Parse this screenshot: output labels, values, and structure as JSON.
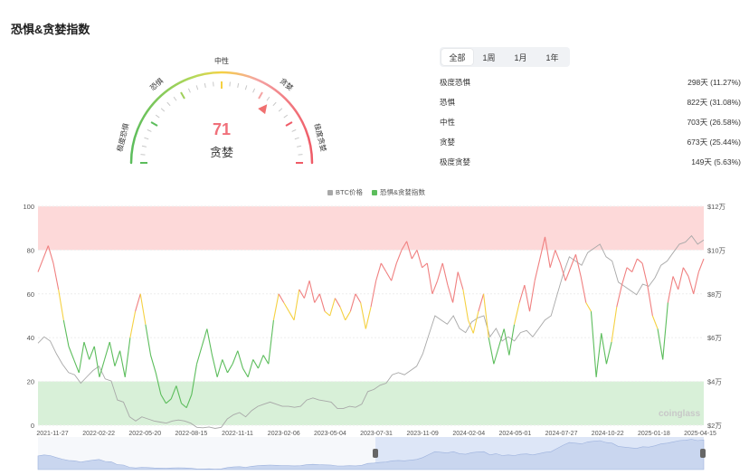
{
  "title": "恐惧&贪婪指数",
  "gauge": {
    "value": "71",
    "state": "贪婪",
    "labels": {
      "extreme_fear": "极度恐惧",
      "fear": "恐惧",
      "neutral": "中性",
      "greed": "贪婪",
      "extreme_greed": "极度贪婪"
    },
    "value_color": "#f0707a"
  },
  "tabs": [
    {
      "label": "全部",
      "active": true
    },
    {
      "label": "1周",
      "active": false
    },
    {
      "label": "1月",
      "active": false
    },
    {
      "label": "1年",
      "active": false
    }
  ],
  "stats": [
    {
      "label": "极度恐惧",
      "value": "298天 (11.27%)"
    },
    {
      "label": "恐惧",
      "value": "822天 (31.08%)"
    },
    {
      "label": "中性",
      "value": "703天 (26.58%)"
    },
    {
      "label": "贪婪",
      "value": "673天 (25.44%)"
    },
    {
      "label": "极度贪婪",
      "value": "149天 (5.63%)"
    }
  ],
  "legend": [
    {
      "label": "BTC价格",
      "color": "#a8a8a8"
    },
    {
      "label": "恐惧&贪婪指数",
      "color": "#5cbd5c"
    }
  ],
  "watermark": "coinglass",
  "chart_data": {
    "type": "line",
    "x": [
      "2021-11-27",
      "2022-02-22",
      "2022-05-20",
      "2022-08-15",
      "2022-11-11",
      "2023-02-06",
      "2023-05-04",
      "2023-07-31",
      "2023-11-09",
      "2024-02-04",
      "2024-05-01",
      "2024-07-27",
      "2024-10-22",
      "2025-01-18",
      "2025-04-15"
    ],
    "y_left": {
      "ticks": [
        "0",
        "20",
        "40",
        "60",
        "80",
        "100"
      ],
      "range": [
        0,
        100
      ]
    },
    "y_right": {
      "ticks": [
        "$2万",
        "$4万",
        "$6万",
        "$8万",
        "$10万",
        "$12万"
      ],
      "range": [
        18000,
        122000
      ]
    },
    "colors": {
      "extreme_fear": "#5cbd5c",
      "fear": "#5cbd5c",
      "neutral": "#f5d142",
      "greed": "#f08080",
      "extreme_greed": "#f08080",
      "btc": "#a8a8a8",
      "band_top": "#fdd9d9",
      "band_bottom": "#d8f0d8"
    },
    "series": [
      {
        "name": "恐惧&贪婪指数",
        "values": [
          70,
          76,
          82,
          74,
          62,
          48,
          36,
          30,
          24,
          38,
          30,
          36,
          22,
          30,
          38,
          27,
          34,
          22,
          40,
          52,
          60,
          46,
          32,
          24,
          14,
          10,
          12,
          18,
          10,
          8,
          14,
          28,
          36,
          44,
          32,
          22,
          30,
          24,
          28,
          34,
          26,
          22,
          30,
          26,
          32,
          28,
          48,
          60,
          56,
          52,
          48,
          62,
          58,
          66,
          56,
          60,
          52,
          50,
          58,
          54,
          48,
          52,
          60,
          56,
          44,
          54,
          66,
          74,
          70,
          66,
          74,
          80,
          84,
          76,
          80,
          72,
          74,
          60,
          66,
          74,
          64,
          56,
          70,
          62,
          48,
          42,
          52,
          60,
          40,
          28,
          36,
          44,
          32,
          46,
          56,
          64,
          52,
          66,
          76,
          86,
          72,
          80,
          74,
          66,
          72,
          78,
          68,
          56,
          52,
          22,
          42,
          28,
          38,
          54,
          64,
          72,
          70,
          76,
          74,
          64,
          50,
          44,
          30,
          56,
          68,
          62,
          72,
          68,
          60,
          70,
          76
        ]
      },
      {
        "name": "BTC价格",
        "values": [
          57000,
          60000,
          58000,
          52000,
          47000,
          43000,
          42000,
          38000,
          41000,
          44000,
          46000,
          40000,
          39000,
          30000,
          29000,
          22000,
          20000,
          22000,
          21000,
          20000,
          19500,
          19000,
          20000,
          20500,
          20000,
          19000,
          17000,
          16800,
          17200,
          16500,
          17000,
          21000,
          23000,
          24000,
          22000,
          25000,
          27000,
          28000,
          29000,
          28000,
          27000,
          27000,
          26500,
          27000,
          30000,
          31000,
          30000,
          29500,
          29000,
          26000,
          26000,
          27000,
          26500,
          28000,
          34000,
          35000,
          37000,
          38000,
          42000,
          43000,
          42000,
          44000,
          46000,
          52000,
          61000,
          70000,
          68000,
          66000,
          70000,
          64000,
          62000,
          67000,
          69000,
          70000,
          60000,
          64000,
          58000,
          60000,
          58000,
          62000,
          63000,
          60000,
          64000,
          68000,
          70000,
          80000,
          90000,
          98000,
          96000,
          94000,
          100000,
          102000,
          104000,
          98000,
          96000,
          86000,
          84000,
          82000,
          80000,
          85000,
          84000,
          88000,
          94000,
          96000,
          100000,
          104000,
          105000,
          108000,
          104000,
          106000
        ]
      }
    ]
  }
}
